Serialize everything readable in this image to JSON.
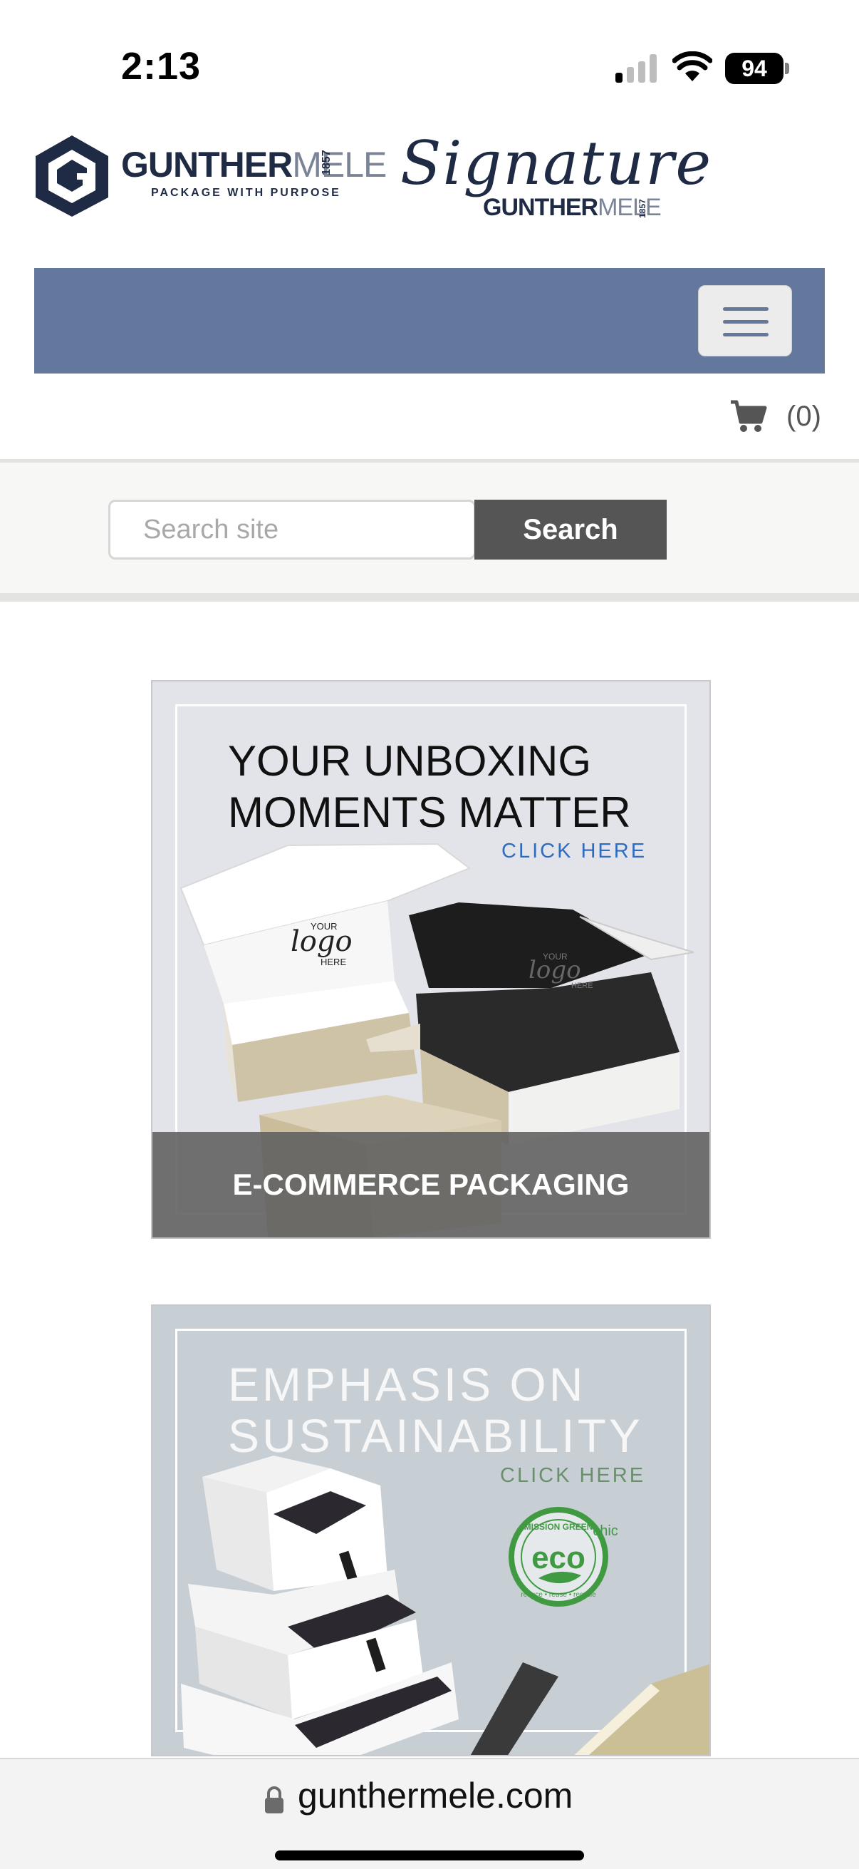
{
  "status_bar": {
    "time": "2:13",
    "battery": "94",
    "icons": [
      "cellular-signal-icon",
      "wifi-icon",
      "battery-icon"
    ]
  },
  "header": {
    "logo_main": {
      "name": "GUNTHER",
      "name_light": "MELE",
      "year": "1857",
      "tagline": "PACKAGE WITH PURPOSE"
    },
    "logo_signature": {
      "script": "Signature",
      "name": "GUNTHER",
      "name_light": "MELE",
      "year": "1857"
    }
  },
  "nav": {
    "bar_color": "#64779c",
    "menu_icon": "hamburger-menu-icon",
    "cart_icon": "shopping-cart-icon",
    "cart_count": "(0)"
  },
  "search": {
    "placeholder": "Search site",
    "value": "",
    "button_label": "Search"
  },
  "promos": [
    {
      "headline_line1": "YOUR UNBOXING",
      "headline_line2": "MOMENTS MATTER",
      "cta": "CLICK HERE",
      "box_logo_lines": [
        "YOUR",
        "logo",
        "HERE"
      ],
      "label": "E-COMMERCE PACKAGING"
    },
    {
      "headline_line1": "EMPHASIS ON",
      "headline_line2": "SUSTAINABILITY",
      "cta": "CLICK HERE",
      "badge": {
        "top_text": "MISSION GREEN",
        "main": "eco",
        "suffix": "chic",
        "bottom_text": "reduce • reuse • recycle"
      }
    }
  ],
  "browser": {
    "url": "gunthermele.com",
    "lock_icon": "lock-icon"
  },
  "colors": {
    "accent": "#64779c",
    "button_dark": "#555555",
    "cta_blue": "#2f6bbf",
    "eco_green": "#3f9a41"
  }
}
